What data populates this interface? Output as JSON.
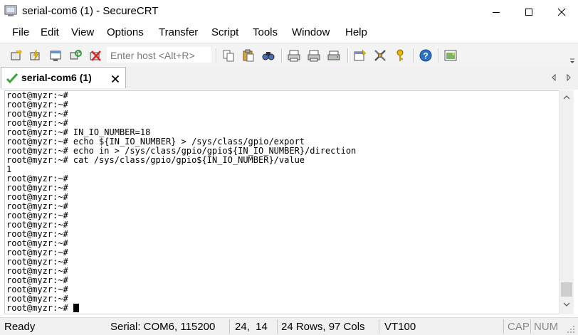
{
  "window": {
    "title": "serial-com6 (1) - SecureCRT"
  },
  "menu": [
    "File",
    "Edit",
    "View",
    "Options",
    "Transfer",
    "Script",
    "Tools",
    "Window",
    "Help"
  ],
  "toolbar": {
    "host_placeholder": "Enter host <Alt+R>"
  },
  "tab": {
    "label": "serial-com6 (1)",
    "close": "x"
  },
  "terminal": {
    "lines": [
      "root@myzr:~#",
      "root@myzr:~#",
      "root@myzr:~#",
      "root@myzr:~#",
      "root@myzr:~# IN_IO_NUMBER=18",
      "root@myzr:~# echo ${IN_IO_NUMBER} > /sys/class/gpio/export",
      "root@myzr:~# echo in > /sys/class/gpio/gpio${IN_IO_NUMBER}/direction",
      "root@myzr:~# cat /sys/class/gpio/gpio${IN_IO_NUMBER}/value",
      "1",
      "root@myzr:~#",
      "root@myzr:~#",
      "root@myzr:~#",
      "root@myzr:~#",
      "root@myzr:~#",
      "root@myzr:~#",
      "root@myzr:~#",
      "root@myzr:~#",
      "root@myzr:~#",
      "root@myzr:~#",
      "root@myzr:~#",
      "root@myzr:~#",
      "root@myzr:~#",
      "root@myzr:~#",
      "root@myzr:~# "
    ]
  },
  "status": {
    "ready": "Ready",
    "connection": "Serial: COM6, 115200",
    "cursor_pos": "24,  14",
    "dimensions": "24 Rows, 97 Cols",
    "emulation": "VT100",
    "caps": "CAP",
    "num": "NUM"
  },
  "colors": {
    "accent": "#2a72c4",
    "tab_check": "#3aa53a",
    "toolbar_bg": "#f3f3f3"
  }
}
